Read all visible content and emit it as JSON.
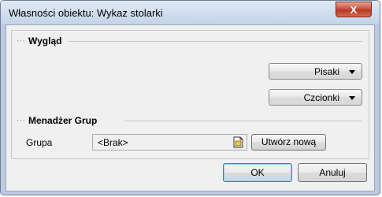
{
  "window": {
    "title": "Własności obiektu: Wykaz stolarki",
    "close_label": "X"
  },
  "appearance": {
    "section_label": "Wygląd",
    "pens_label": "Pisaki",
    "fonts_label": "Czcionki"
  },
  "group_manager": {
    "section_label": "Menadżer Grup",
    "group_label": "Grupa",
    "group_value": "<Brak>",
    "create_new_label": "Utwórz nową"
  },
  "footer": {
    "ok_label": "OK",
    "cancel_label": "Anuluj"
  },
  "colors": {
    "frame": "#bccbe2",
    "close_button": "#c9523c",
    "default_button_border": "#3c7fb1"
  }
}
